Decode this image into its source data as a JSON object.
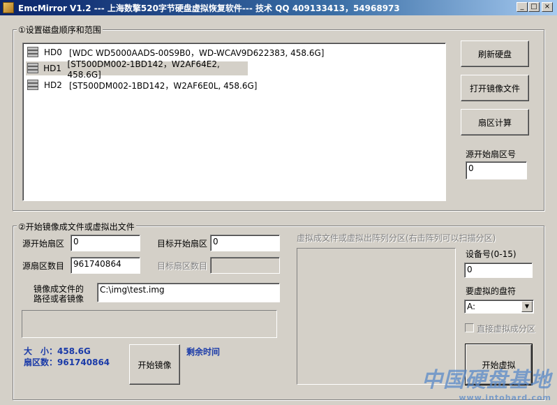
{
  "window": {
    "title": "EmcMirror V1.2 --- 上海数擎520字节硬盘虚拟恢复软件--- 技术 QQ 409133413，54968973",
    "minimize_glyph": "_",
    "maximize_glyph": "□",
    "close_glyph": "×"
  },
  "group1": {
    "label": "①设置磁盘顺序和范围",
    "disks": [
      {
        "name": "HD0",
        "info": "[WDC WD5000AADS-00S9B0，WD-WCAV9D622383, 458.6G]"
      },
      {
        "name": "HD1",
        "info": "[ST500DM002-1BD142，W2AF64E2, 458.6G]"
      },
      {
        "name": "HD2",
        "info": "[ST500DM002-1BD142，W2AF6E0L, 458.6G]"
      }
    ],
    "refresh_button": "刷新硬盘",
    "open_image_button": "打开镜像文件",
    "sector_calc_button": "扇区计算",
    "src_start_label": "源开始扇区号",
    "src_start_value": "0"
  },
  "group2": {
    "label": "②开始镜像成文件或虚拟出文件",
    "src_start_label": "源开始扇区",
    "src_start_value": "0",
    "dst_start_label": "目标开始扇区",
    "dst_start_value": "0",
    "src_count_label": "源扇区数目",
    "src_count_value": "961740864",
    "dst_count_label": "目标扇区数目",
    "dst_count_value": "",
    "path_label_line1": "镜像成文件的",
    "path_label_line2": "路径或者镜像",
    "path_value": "C:\\img\\test.img",
    "size_text": "大　小：458.6G",
    "sectors_text": "扇区数：961740864",
    "start_mirror_button": "开始镜像",
    "remaining_label": "剩余时间",
    "virtual_label": "虚拟成文件或虚拟出阵列分区(右击阵列可以扫描分区)",
    "device_label": "设备号(0-15)",
    "device_value": "0",
    "drive_label": "要虚拟的盘符",
    "drive_value": "A:",
    "direct_virtual_label": "直接虚拟成分区",
    "start_virtual_button": "开始虚拟"
  },
  "watermark": {
    "line1": "中国硬盘基地",
    "line2": "www.intohard.com"
  }
}
